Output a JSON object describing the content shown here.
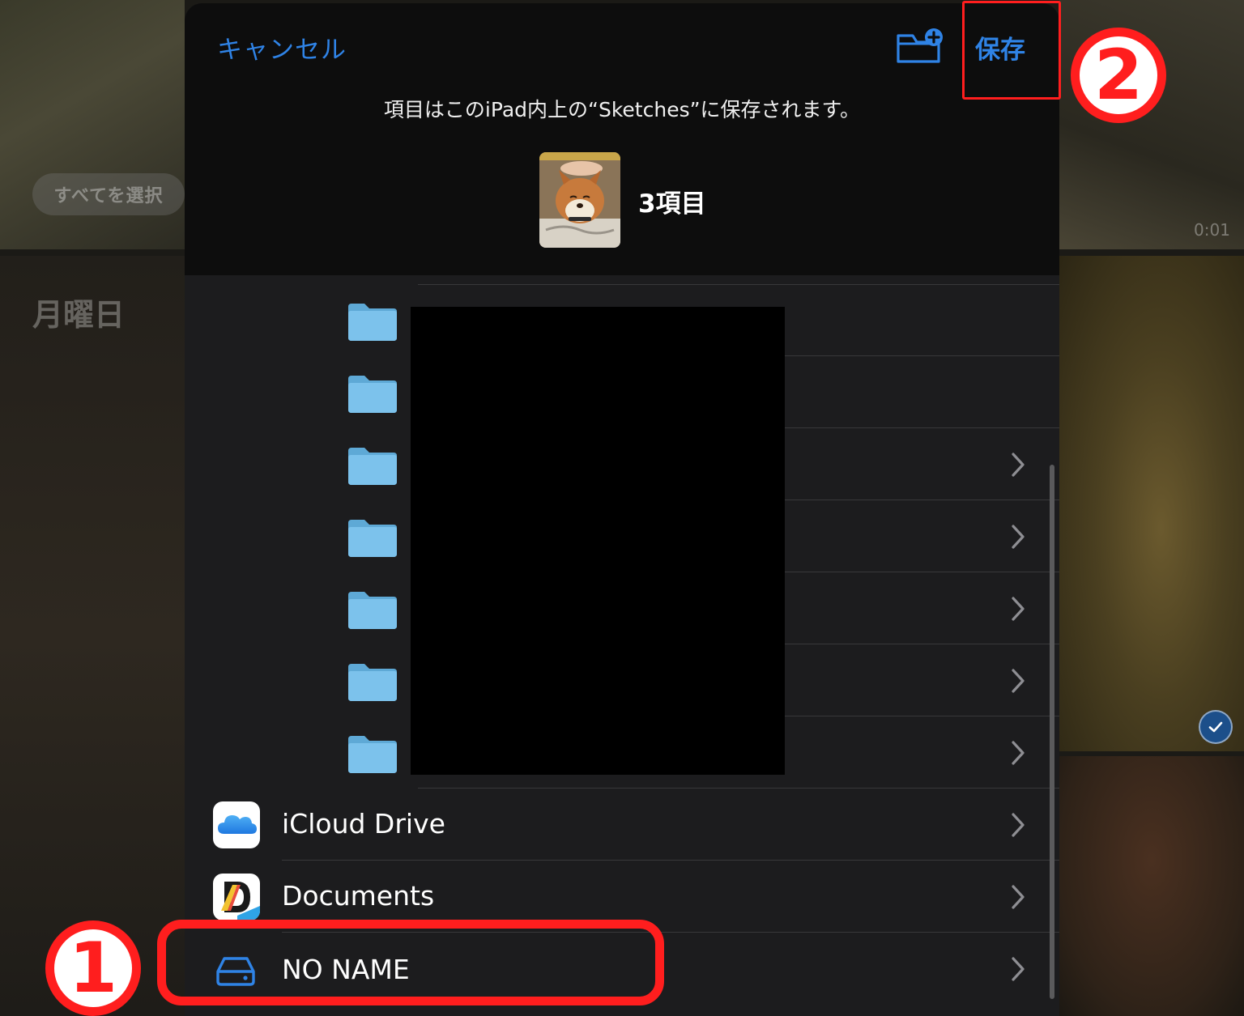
{
  "background": {
    "select_all_label": "すべてを選択",
    "day_label": "月曜日",
    "video_duration": "0:01"
  },
  "header": {
    "cancel_label": "キャンセル",
    "save_label": "保存",
    "destination_text": "項目はこのiPad内上の“Sketches”に保存されます。",
    "item_count": "3項目"
  },
  "folder_rows": [
    {
      "has_chevron": false
    },
    {
      "has_chevron": false
    },
    {
      "has_chevron": true
    },
    {
      "has_chevron": true
    },
    {
      "has_chevron": true
    },
    {
      "has_chevron": true
    },
    {
      "has_chevron": true
    }
  ],
  "locations": [
    {
      "label": "iCloud Drive",
      "icon": "icloud-icon"
    },
    {
      "label": "Documents",
      "icon": "documents-app-icon"
    },
    {
      "label": "NO NAME",
      "icon": "external-drive-icon"
    }
  ],
  "annotations": {
    "step1": "1",
    "step2": "2"
  },
  "colors": {
    "accent": "#2f83e6",
    "annotation_red": "#ff1e1e",
    "sheet_bg": "#1c1c1e",
    "header_bg": "#0d0d0d",
    "folder_blue": "#7cc2ec"
  }
}
